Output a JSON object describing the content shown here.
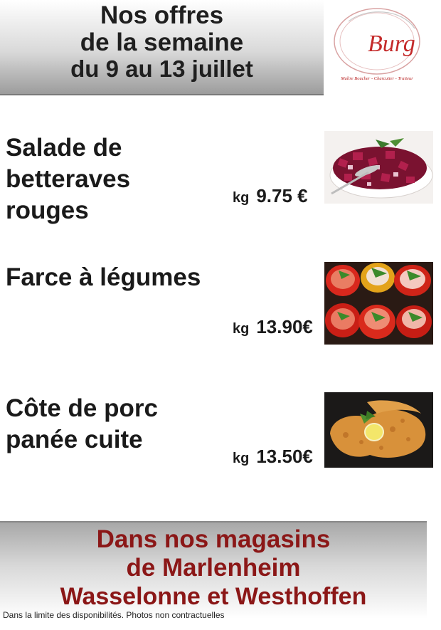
{
  "header": {
    "title_lines": [
      "Nos offres",
      "de la semaine",
      "du 9 au 13 juillet"
    ]
  },
  "logo": {
    "monogram": "Burg",
    "tagline": "Maître Boucher - Charcutier - Traiteur",
    "colors": {
      "monogram": "#c42a2a",
      "tagline": "#b71f1f"
    }
  },
  "products": [
    {
      "name": "Salade de\nbetteraves\nrouges",
      "unit": "kg",
      "price": "9.75 €",
      "photo_icon": "beetroot-salad-photo"
    },
    {
      "name": "Farce à légumes",
      "unit": "kg",
      "price": "13.90€",
      "photo_icon": "stuffed-tomatoes-photo"
    },
    {
      "name": "Côte de porc\npanée cuite",
      "unit": "kg",
      "price": "13.50€",
      "photo_icon": "breaded-pork-chop-photo"
    }
  ],
  "footer": {
    "lines": [
      "Dans nos magasins",
      "de Marlenheim",
      "Wasselonne et Westhoffen"
    ],
    "color": "#8b1717"
  },
  "disclaimer": "Dans la limite des disponibilités. Photos non contractuelles"
}
